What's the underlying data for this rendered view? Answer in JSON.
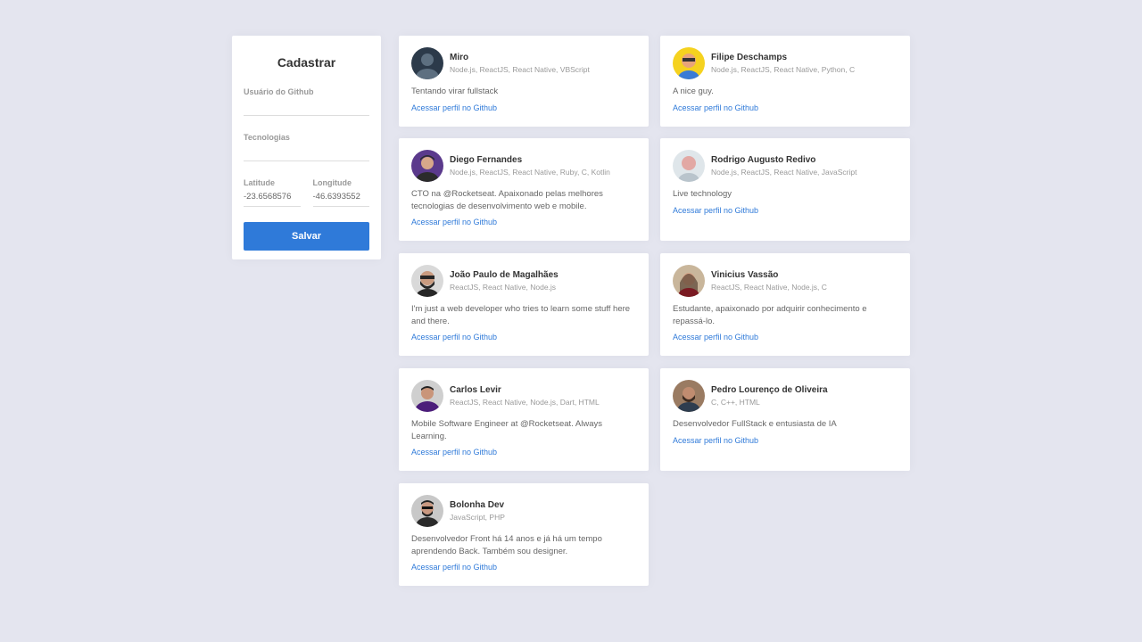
{
  "form": {
    "title": "Cadastrar",
    "github_label": "Usuário do Github",
    "github_value": "",
    "techs_label": "Tecnologias",
    "techs_value": "",
    "latitude_label": "Latitude",
    "latitude_value": "-23.6568576",
    "longitude_label": "Longitude",
    "longitude_value": "-46.6393552",
    "save_label": "Salvar"
  },
  "link_label": "Acessar perfil no Github",
  "devs": [
    {
      "name": "Miro",
      "techs": "Node.js, ReactJS, React Native, VBScript",
      "bio": "Tentando virar fullstack",
      "avatar_bg": "#2c3a4a",
      "avatar_fg": "#5d6f80"
    },
    {
      "name": "Filipe Deschamps",
      "techs": "Node.js, ReactJS, React Native, Python, C",
      "bio": "A nice guy.",
      "avatar_bg": "#f5d21f",
      "avatar_fg": "#e8a47a"
    },
    {
      "name": "Diego Fernandes",
      "techs": "Node.js, ReactJS, React Native, Ruby, C, Kotlin",
      "bio": "CTO na @Rocketseat. Apaixonado pelas melhores tecnologias de desenvolvimento web e mobile.",
      "avatar_bg": "#5b3a8c",
      "avatar_fg": "#2b2b2b"
    },
    {
      "name": "Rodrigo Augusto Redivo",
      "techs": "Node.js, ReactJS, React Native, JavaScript",
      "bio": "Live technology",
      "avatar_bg": "#dfe6ea",
      "avatar_fg": "#e2a8a4"
    },
    {
      "name": "João Paulo de Magalhães",
      "techs": "ReactJS, React Native, Node.js",
      "bio": "I'm just a web developer who tries to learn some stuff here and there.",
      "avatar_bg": "#d9d9d9",
      "avatar_fg": "#262626"
    },
    {
      "name": "Vinicius Vassão",
      "techs": "ReactJS, React Native, Node.js, C",
      "bio": "Estudante, apaixonado por adquirir conhecimento e repassá-lo.",
      "avatar_bg": "#c9b69b",
      "avatar_fg": "#7a1a22"
    },
    {
      "name": "Carlos Levir",
      "techs": "ReactJS, React Native, Node.js, Dart, HTML",
      "bio": "Mobile Software Engineer at @Rocketseat. Always Learning.",
      "avatar_bg": "#cfcfcf",
      "avatar_fg": "#4b1d7a"
    },
    {
      "name": "Pedro Lourenço de Oliveira",
      "techs": "C, C++, HTML",
      "bio": "Desenvolvedor FullStack e entusiasta de IA",
      "avatar_bg": "#9a7b62",
      "avatar_fg": "#2e3d4f"
    },
    {
      "name": "Bolonha Dev",
      "techs": "JavaScript, PHP",
      "bio": "Desenvolvedor Front há 14 anos e já há um tempo aprendendo Back. Também sou designer.",
      "avatar_bg": "#c8c8c8",
      "avatar_fg": "#2a2a2a"
    }
  ]
}
